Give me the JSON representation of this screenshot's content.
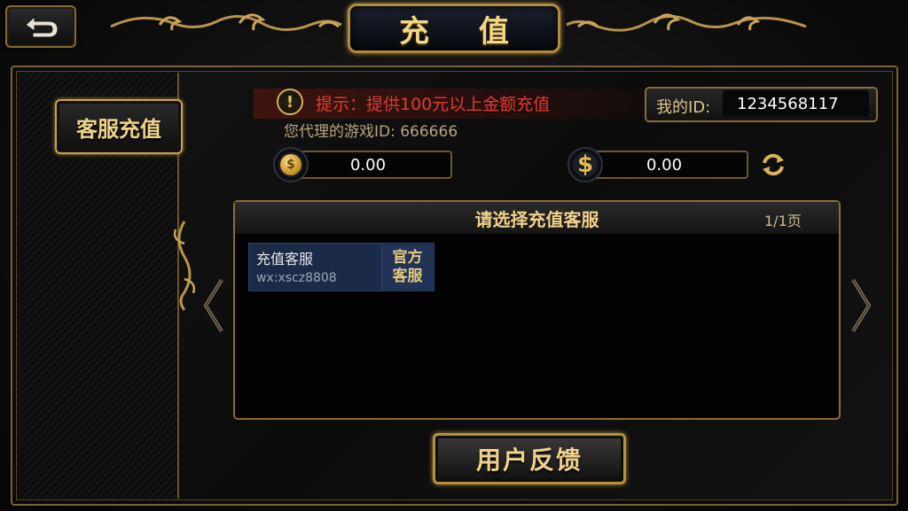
{
  "header": {
    "title": "充 值"
  },
  "sidebar": {
    "tab_label": "客服充值"
  },
  "notice": {
    "text": "提示：提供100元以上金额充值"
  },
  "agent": {
    "game_id_text": "您代理的游戏ID: 666666"
  },
  "my_id": {
    "label": "我的ID:",
    "value": "1234568117"
  },
  "balances": {
    "gold": "0.00",
    "cash": "0.00"
  },
  "list": {
    "title": "请选择充值客服",
    "page": "1/1页",
    "items": [
      {
        "name": "充值客服",
        "wx": "wx:xscz8808",
        "badge_line1": "官方",
        "badge_line2": "客服"
      }
    ]
  },
  "footer": {
    "feedback_label": "用户反馈"
  },
  "icons": [
    "back-arrow-icon",
    "warning-icon",
    "gold-coin-icon",
    "dollar-icon",
    "refresh-icon",
    "chevron-left-icon",
    "chevron-right-icon"
  ],
  "colors": {
    "gold": "#f0d28a",
    "warning_red": "#e13b32",
    "card_blue": "#1b2b47"
  }
}
